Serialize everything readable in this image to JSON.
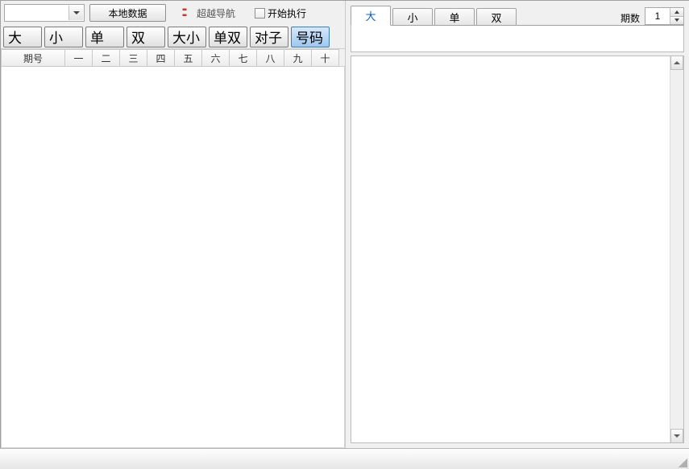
{
  "toolbar": {
    "local_data_label": "本地数据",
    "nav_link_label": "超越导航",
    "start_exec_label": "开始执行"
  },
  "mode_buttons": {
    "big": "大",
    "small": "小",
    "odd": "单",
    "even": "双",
    "bigsmall": "大小",
    "oddeven": "单双",
    "pair": "对子",
    "number": "号码"
  },
  "columns": {
    "period": "期号",
    "c1": "一",
    "c2": "二",
    "c3": "三",
    "c4": "四",
    "c5": "五",
    "c6": "六",
    "c7": "七",
    "c8": "八",
    "c9": "九",
    "c10": "十"
  },
  "tabs": {
    "big": "大",
    "small": "小",
    "odd": "单",
    "even": "双"
  },
  "period_count": {
    "label": "期数",
    "value": "1"
  }
}
